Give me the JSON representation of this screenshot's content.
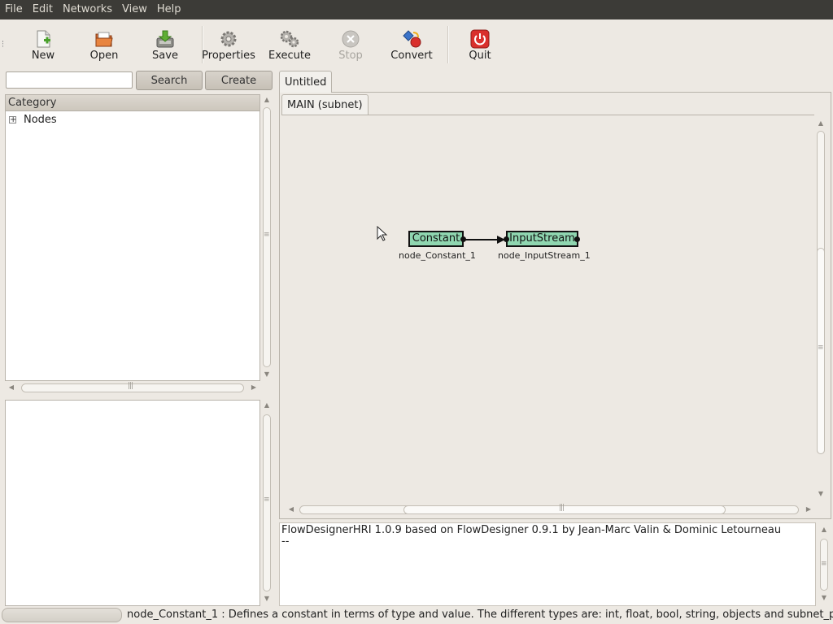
{
  "menubar": {
    "items": [
      "File",
      "Edit",
      "Networks",
      "View",
      "Help"
    ]
  },
  "toolbar": {
    "new": {
      "label": "New",
      "icon": "new-file-icon"
    },
    "open": {
      "label": "Open",
      "icon": "open-folder-icon"
    },
    "save": {
      "label": "Save",
      "icon": "save-icon"
    },
    "properties": {
      "label": "Properties",
      "icon": "gear-icon"
    },
    "execute": {
      "label": "Execute",
      "icon": "gears-icon"
    },
    "stop": {
      "label": "Stop",
      "icon": "stop-icon",
      "disabled": true
    },
    "convert": {
      "label": "Convert",
      "icon": "convert-icon"
    },
    "quit": {
      "label": "Quit",
      "icon": "power-icon"
    }
  },
  "search": {
    "value": "",
    "search_label": "Search",
    "create_label": "Create"
  },
  "tree": {
    "header": "Category",
    "items": [
      {
        "label": "Nodes",
        "expander": "+"
      }
    ]
  },
  "document": {
    "tab": "Untitled",
    "subnet_tab": "MAIN (subnet)",
    "nodes": [
      {
        "label": "Constant",
        "name": "node_Constant_1"
      },
      {
        "label": "InputStream",
        "name": "node_InputStream_1"
      }
    ]
  },
  "log": {
    "lines": [
      "FlowDesignerHRI 1.0.9 based on FlowDesigner 0.9.1 by Jean-Marc Valin & Dominic Letourneau",
      "--"
    ]
  },
  "status": {
    "text": "node_Constant_1 : Defines a constant in terms of type and value. The different types are: int, float, bool, string, objects and subnet_param."
  },
  "colors": {
    "menubar_bg": "#3c3b37",
    "node_fill": "#8fd6b0",
    "quit_red": "#d9302c"
  }
}
